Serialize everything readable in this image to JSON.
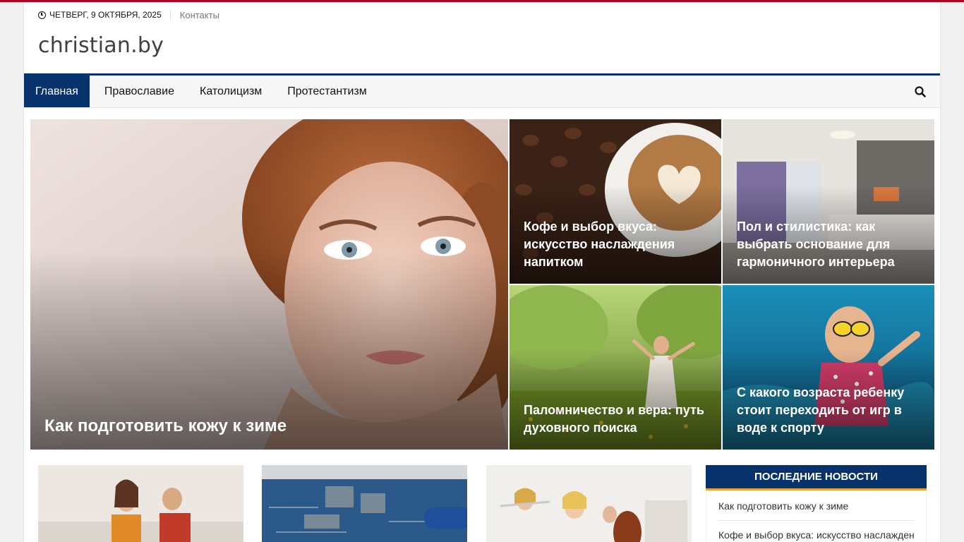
{
  "topbar": {
    "date": "ЧЕТВЕРГ, 9 ОКТЯБРЯ, 2025",
    "contacts": "Контакты"
  },
  "site": {
    "title": "christian.by"
  },
  "nav": {
    "items": [
      {
        "label": "Главная",
        "active": true
      },
      {
        "label": "Православие"
      },
      {
        "label": "Католицизм"
      },
      {
        "label": "Протестантизм"
      }
    ]
  },
  "featured": {
    "main": {
      "title": "Как подготовить кожу к зиме",
      "image": "woman-portrait"
    },
    "side": [
      {
        "title": "Кофе и выбор вкуса: искусство наслаждения напитком",
        "image": "coffee-cup"
      },
      {
        "title": "Пол и стилистика: как выбрать основание для гармоничного интерьера",
        "image": "hotel-room"
      },
      {
        "title": "Паломничество и вера: путь духовного поиска",
        "image": "woman-in-field"
      },
      {
        "title": "С какого возраста ребенку стоит переходить от игр в воде к спорту",
        "image": "child-underwater"
      }
    ]
  },
  "cards": [
    {
      "image": "couple-sofa"
    },
    {
      "image": "circuit-board-repair"
    },
    {
      "image": "children-musicians"
    }
  ],
  "sidebar": {
    "heading": "ПОСЛЕДНИЕ НОВОСТИ",
    "items": [
      "Как подготовить кожу к зиме",
      "Кофе и выбор вкуса: искусство наслаждения напитком"
    ]
  },
  "colors": {
    "primary": "#08326b",
    "accent_top": "#b20024",
    "sidebar_underline": "#e7a23a"
  }
}
